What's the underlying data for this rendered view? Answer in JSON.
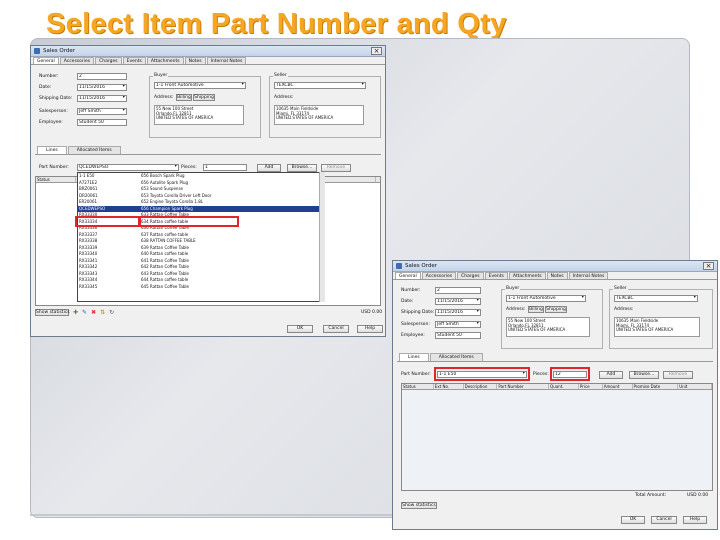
{
  "slide": {
    "title": "Select Item Part Number and Qty"
  },
  "win1": {
    "title": "Sales Order",
    "tabs": [
      "General",
      "Accessories",
      "Charges",
      "Events",
      "Attachments",
      "Notes",
      "Internal Notes"
    ],
    "number_label": "Number:",
    "number_value": "2",
    "date_label": "Date:",
    "date_value": "11/15/2016",
    "shipping_date_label": "Shipping Date:",
    "shipping_date_value": "11/15/2016",
    "salesperson_label": "Salesperson:",
    "salesperson_value": "Jeff Smith",
    "employee_label": "Employee:",
    "employee_value": "Student 50",
    "buyer_group": "Buyer",
    "buyer_value": "1-1 Front Automotive",
    "address_label": "Address:",
    "billing": "Billing",
    "shipping": "Shipping",
    "buyer_address": "55 New 100 Street\nOrlando,FL 32811\nUNITED STATES OF AMERICA",
    "seller_group": "Seller",
    "seller_value": "TEXCBC",
    "seller_address_label": "Address:",
    "seller_address": "10635 Main Fieldside\nMiami, FL 33174\nUNITED STATES OF AMERICA",
    "subtabs": [
      "Lines",
      "Allocated Items"
    ],
    "part_label": "Part Number:",
    "part_value": "QCEDWEPSO",
    "pieces_label": "Pieces:",
    "pieces_value": "1",
    "add": "Add",
    "browse": "Browse...",
    "remove": "Remove",
    "grid_cols": [
      "Status",
      "Part Number",
      "Description",
      "Customer"
    ],
    "rows": [
      {
        "part": "1-1 E50",
        "desc": "656 Bosch Spark Plug"
      },
      {
        "part": "A7271E2",
        "desc": "656 Autolite Spark Plug"
      },
      {
        "part": "BRZ0061",
        "desc": "653 Sound Suspense"
      },
      {
        "part": "DR20061",
        "desc": "653 Toyota Corolla Driver Left Door"
      },
      {
        "part": "ER20061",
        "desc": "652 Engine Toyota Corolla 1.8L"
      },
      {
        "part": "QCEDWEPSO",
        "desc": "656 Champion Spark Plug"
      },
      {
        "part": "RX33330",
        "desc": "633 Rattan Coffee Table"
      },
      {
        "part": "RX33334",
        "desc": "634 Rattan coffee table"
      },
      {
        "part": "RX33336",
        "desc": "636 Rattan Coffee Table"
      },
      {
        "part": "RX33337",
        "desc": "637 Rattan coffee table"
      },
      {
        "part": "RX33338",
        "desc": "638 RATTAN COFFEE TABLE"
      },
      {
        "part": "RX33339",
        "desc": "639 Rattan Coffee Table"
      },
      {
        "part": "RX33340",
        "desc": "640 Rattan coffee table"
      },
      {
        "part": "RX33341",
        "desc": "641 Rattan Coffee Table"
      },
      {
        "part": "RX33342",
        "desc": "642 Rattan Coffee Table"
      },
      {
        "part": "RX33343",
        "desc": "643 Rattan Coffee Table"
      },
      {
        "part": "RX33344",
        "desc": "644 Rattan coffee table"
      },
      {
        "part": "RX33345",
        "desc": "645 Rattan Coffee Table"
      }
    ],
    "selected_index": 5,
    "show_statistics": "Show statistics",
    "total": "USD 0.00",
    "ok": "OK",
    "cancel": "Cancel",
    "help": "Help"
  },
  "win2": {
    "title": "Sales Order",
    "tabs": [
      "General",
      "Accessories",
      "Charges",
      "Events",
      "Attachments",
      "Notes",
      "Internal Notes"
    ],
    "number_label": "Number:",
    "number_value": "2",
    "date_label": "Date:",
    "date_value": "11/15/2016",
    "shipping_date_label": "Shipping Date:",
    "shipping_date_value": "11/15/2016",
    "salesperson_label": "Salesperson:",
    "salesperson_value": "Jeff Smith",
    "employee_label": "Employee:",
    "employee_value": "Student 50",
    "buyer_group": "Buyer",
    "buyer_value": "1-1 Front Automotive",
    "address_label": "Address:",
    "billing": "Billing",
    "shipping": "Shipping",
    "buyer_address": "55 New 100 Street\nOrlando,FL 32811\nUNITED STATES OF AMERICA",
    "seller_group": "Seller",
    "seller_value": "TEXCBC",
    "seller_address_label": "Address:",
    "seller_address": "10635 Main Fieldside\nMiami, FL 33174\nUNITED STATES OF AMERICA",
    "subtabs": [
      "Lines",
      "Allocated Items"
    ],
    "part_label": "Part Number:",
    "part_value": "1-1 E50",
    "pieces_label": "Pieces:",
    "pieces_value": "12",
    "add": "Add",
    "browse": "Browse...",
    "remove": "Remove",
    "grid_cols": [
      "Status",
      "Ext No.",
      "Description",
      "Part Number",
      "Quant.",
      "Price",
      "Amount",
      "Promise Date",
      "Unit"
    ],
    "show_statistics": "Show statistics",
    "total_label": "Total Amount:",
    "total": "USD 0.00",
    "ok": "OK",
    "cancel": "Cancel",
    "help": "Help"
  },
  "colors": {
    "title": "#f5a623",
    "highlight": "#e0262a",
    "selection": "#1f3f8f"
  }
}
